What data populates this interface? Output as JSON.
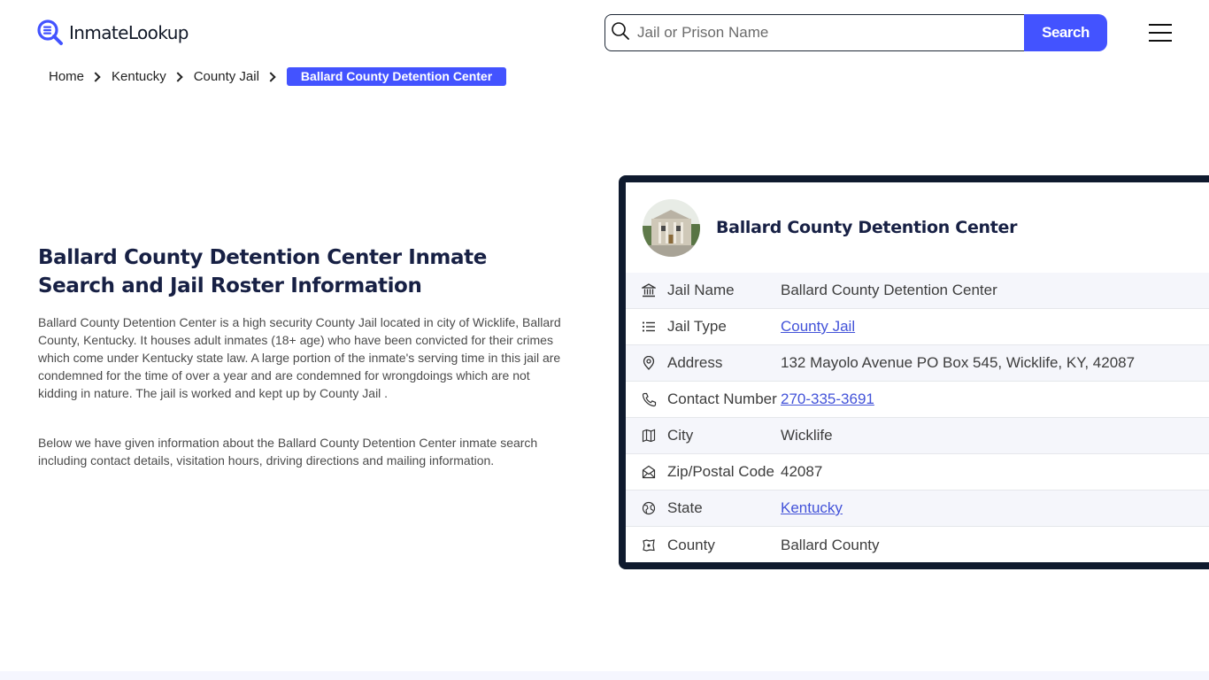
{
  "header": {
    "logo_text": "InmateLookup",
    "search": {
      "placeholder": "Jail or Prison Name",
      "value": "",
      "button_label": "Search"
    },
    "menu_icon": "hamburger-icon"
  },
  "breadcrumb": {
    "items": [
      "Home",
      "Kentucky",
      "County Jail"
    ],
    "current": "Ballard County Detention Center"
  },
  "main": {
    "title": "Ballard County Detention Center Inmate Search and Jail Roster Information",
    "paragraphs": [
      "Ballard County Detention Center is a high security County Jail located in city of Wicklife, Ballard County, Kentucky. It houses adult inmates (18+ age) who have been convicted for their crimes which come under Kentucky state law. A large portion of the inmate's serving time in this jail are condemned for the time of over a year and are condemned for wrongdoings which are not kidding in nature. The jail is worked and kept up by County Jail .",
      "Below we have given information about the Ballard County Detention Center inmate search including contact details, visitation hours, driving directions and mailing information."
    ]
  },
  "card": {
    "title": "Ballard County Detention Center",
    "rows": [
      {
        "icon": "building-icon",
        "label": "Jail Name",
        "value": "Ballard County Detention Center",
        "link": false
      },
      {
        "icon": "list-icon",
        "label": "Jail Type",
        "value": "County Jail",
        "link": true
      },
      {
        "icon": "map-pin-icon",
        "label": "Address",
        "value": "132 Mayolo Avenue PO Box 545, Wicklife, KY, 42087",
        "link": false
      },
      {
        "icon": "phone-icon",
        "label": "Contact Number",
        "value": "270-335-3691",
        "link": true
      },
      {
        "icon": "map-icon",
        "label": "City",
        "value": "Wicklife",
        "link": false
      },
      {
        "icon": "mail-icon",
        "label": "Zip/Postal Code",
        "value": "42087",
        "link": false
      },
      {
        "icon": "globe-icon",
        "label": "State",
        "value": "Kentucky",
        "link": true
      },
      {
        "icon": "county-map-icon",
        "label": "County",
        "value": "Ballard County",
        "link": false
      }
    ]
  },
  "colors": {
    "accent": "#4353ff",
    "card_border": "#0f1a2e",
    "title_text": "#172044",
    "row_alt": "#f5f6fb",
    "link": "#4353d9"
  }
}
